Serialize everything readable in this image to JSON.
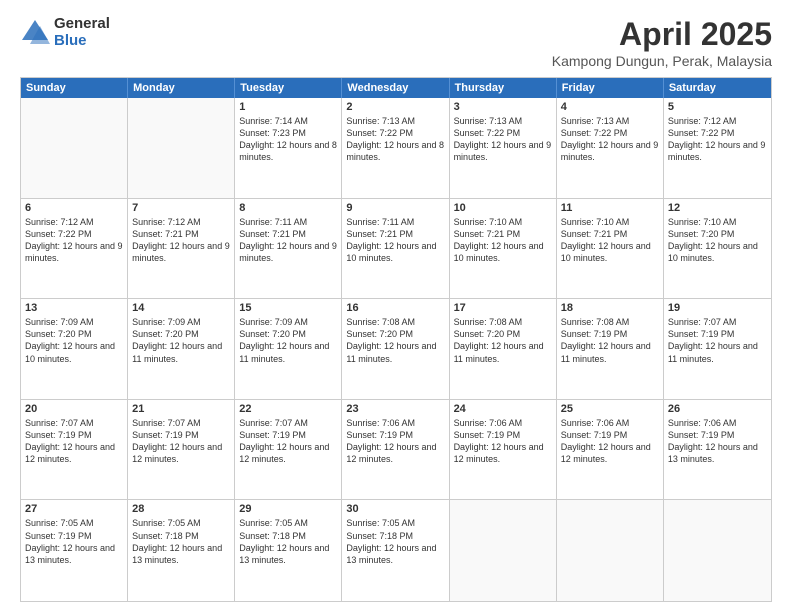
{
  "logo": {
    "general": "General",
    "blue": "Blue"
  },
  "title": "April 2025",
  "location": "Kampong Dungun, Perak, Malaysia",
  "days": [
    "Sunday",
    "Monday",
    "Tuesday",
    "Wednesday",
    "Thursday",
    "Friday",
    "Saturday"
  ],
  "weeks": [
    [
      {
        "day": "",
        "sunrise": "",
        "sunset": "",
        "daylight": ""
      },
      {
        "day": "",
        "sunrise": "",
        "sunset": "",
        "daylight": ""
      },
      {
        "day": "1",
        "sunrise": "Sunrise: 7:14 AM",
        "sunset": "Sunset: 7:23 PM",
        "daylight": "Daylight: 12 hours and 8 minutes."
      },
      {
        "day": "2",
        "sunrise": "Sunrise: 7:13 AM",
        "sunset": "Sunset: 7:22 PM",
        "daylight": "Daylight: 12 hours and 8 minutes."
      },
      {
        "day": "3",
        "sunrise": "Sunrise: 7:13 AM",
        "sunset": "Sunset: 7:22 PM",
        "daylight": "Daylight: 12 hours and 9 minutes."
      },
      {
        "day": "4",
        "sunrise": "Sunrise: 7:13 AM",
        "sunset": "Sunset: 7:22 PM",
        "daylight": "Daylight: 12 hours and 9 minutes."
      },
      {
        "day": "5",
        "sunrise": "Sunrise: 7:12 AM",
        "sunset": "Sunset: 7:22 PM",
        "daylight": "Daylight: 12 hours and 9 minutes."
      }
    ],
    [
      {
        "day": "6",
        "sunrise": "Sunrise: 7:12 AM",
        "sunset": "Sunset: 7:22 PM",
        "daylight": "Daylight: 12 hours and 9 minutes."
      },
      {
        "day": "7",
        "sunrise": "Sunrise: 7:12 AM",
        "sunset": "Sunset: 7:21 PM",
        "daylight": "Daylight: 12 hours and 9 minutes."
      },
      {
        "day": "8",
        "sunrise": "Sunrise: 7:11 AM",
        "sunset": "Sunset: 7:21 PM",
        "daylight": "Daylight: 12 hours and 9 minutes."
      },
      {
        "day": "9",
        "sunrise": "Sunrise: 7:11 AM",
        "sunset": "Sunset: 7:21 PM",
        "daylight": "Daylight: 12 hours and 10 minutes."
      },
      {
        "day": "10",
        "sunrise": "Sunrise: 7:10 AM",
        "sunset": "Sunset: 7:21 PM",
        "daylight": "Daylight: 12 hours and 10 minutes."
      },
      {
        "day": "11",
        "sunrise": "Sunrise: 7:10 AM",
        "sunset": "Sunset: 7:21 PM",
        "daylight": "Daylight: 12 hours and 10 minutes."
      },
      {
        "day": "12",
        "sunrise": "Sunrise: 7:10 AM",
        "sunset": "Sunset: 7:20 PM",
        "daylight": "Daylight: 12 hours and 10 minutes."
      }
    ],
    [
      {
        "day": "13",
        "sunrise": "Sunrise: 7:09 AM",
        "sunset": "Sunset: 7:20 PM",
        "daylight": "Daylight: 12 hours and 10 minutes."
      },
      {
        "day": "14",
        "sunrise": "Sunrise: 7:09 AM",
        "sunset": "Sunset: 7:20 PM",
        "daylight": "Daylight: 12 hours and 11 minutes."
      },
      {
        "day": "15",
        "sunrise": "Sunrise: 7:09 AM",
        "sunset": "Sunset: 7:20 PM",
        "daylight": "Daylight: 12 hours and 11 minutes."
      },
      {
        "day": "16",
        "sunrise": "Sunrise: 7:08 AM",
        "sunset": "Sunset: 7:20 PM",
        "daylight": "Daylight: 12 hours and 11 minutes."
      },
      {
        "day": "17",
        "sunrise": "Sunrise: 7:08 AM",
        "sunset": "Sunset: 7:20 PM",
        "daylight": "Daylight: 12 hours and 11 minutes."
      },
      {
        "day": "18",
        "sunrise": "Sunrise: 7:08 AM",
        "sunset": "Sunset: 7:19 PM",
        "daylight": "Daylight: 12 hours and 11 minutes."
      },
      {
        "day": "19",
        "sunrise": "Sunrise: 7:07 AM",
        "sunset": "Sunset: 7:19 PM",
        "daylight": "Daylight: 12 hours and 11 minutes."
      }
    ],
    [
      {
        "day": "20",
        "sunrise": "Sunrise: 7:07 AM",
        "sunset": "Sunset: 7:19 PM",
        "daylight": "Daylight: 12 hours and 12 minutes."
      },
      {
        "day": "21",
        "sunrise": "Sunrise: 7:07 AM",
        "sunset": "Sunset: 7:19 PM",
        "daylight": "Daylight: 12 hours and 12 minutes."
      },
      {
        "day": "22",
        "sunrise": "Sunrise: 7:07 AM",
        "sunset": "Sunset: 7:19 PM",
        "daylight": "Daylight: 12 hours and 12 minutes."
      },
      {
        "day": "23",
        "sunrise": "Sunrise: 7:06 AM",
        "sunset": "Sunset: 7:19 PM",
        "daylight": "Daylight: 12 hours and 12 minutes."
      },
      {
        "day": "24",
        "sunrise": "Sunrise: 7:06 AM",
        "sunset": "Sunset: 7:19 PM",
        "daylight": "Daylight: 12 hours and 12 minutes."
      },
      {
        "day": "25",
        "sunrise": "Sunrise: 7:06 AM",
        "sunset": "Sunset: 7:19 PM",
        "daylight": "Daylight: 12 hours and 12 minutes."
      },
      {
        "day": "26",
        "sunrise": "Sunrise: 7:06 AM",
        "sunset": "Sunset: 7:19 PM",
        "daylight": "Daylight: 12 hours and 13 minutes."
      }
    ],
    [
      {
        "day": "27",
        "sunrise": "Sunrise: 7:05 AM",
        "sunset": "Sunset: 7:19 PM",
        "daylight": "Daylight: 12 hours and 13 minutes."
      },
      {
        "day": "28",
        "sunrise": "Sunrise: 7:05 AM",
        "sunset": "Sunset: 7:18 PM",
        "daylight": "Daylight: 12 hours and 13 minutes."
      },
      {
        "day": "29",
        "sunrise": "Sunrise: 7:05 AM",
        "sunset": "Sunset: 7:18 PM",
        "daylight": "Daylight: 12 hours and 13 minutes."
      },
      {
        "day": "30",
        "sunrise": "Sunrise: 7:05 AM",
        "sunset": "Sunset: 7:18 PM",
        "daylight": "Daylight: 12 hours and 13 minutes."
      },
      {
        "day": "",
        "sunrise": "",
        "sunset": "",
        "daylight": ""
      },
      {
        "day": "",
        "sunrise": "",
        "sunset": "",
        "daylight": ""
      },
      {
        "day": "",
        "sunrise": "",
        "sunset": "",
        "daylight": ""
      }
    ]
  ]
}
